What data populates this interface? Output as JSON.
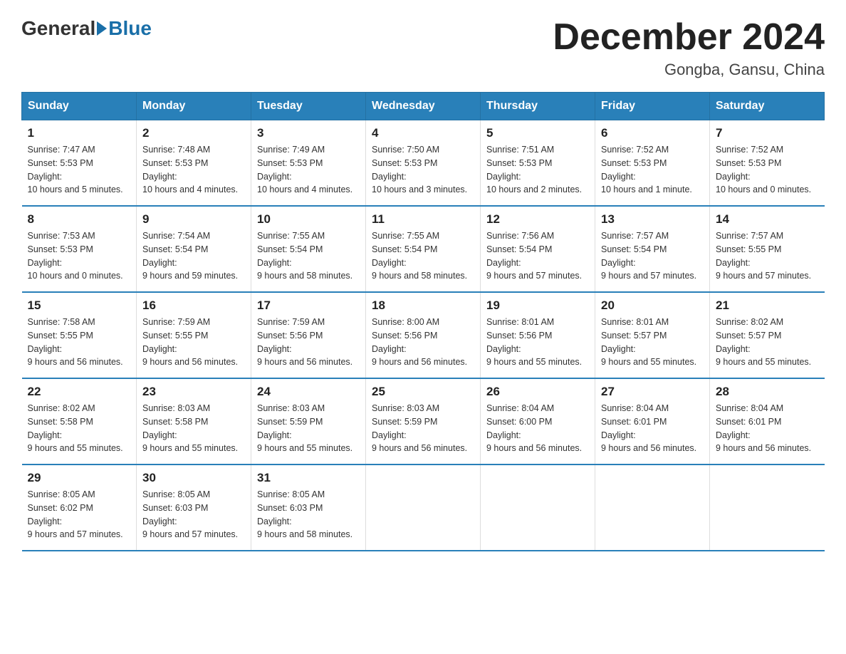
{
  "logo": {
    "general": "General",
    "blue": "Blue"
  },
  "title": "December 2024",
  "subtitle": "Gongba, Gansu, China",
  "days_of_week": [
    "Sunday",
    "Monday",
    "Tuesday",
    "Wednesday",
    "Thursday",
    "Friday",
    "Saturday"
  ],
  "weeks": [
    [
      {
        "day": "1",
        "sunrise": "7:47 AM",
        "sunset": "5:53 PM",
        "daylight": "10 hours and 5 minutes."
      },
      {
        "day": "2",
        "sunrise": "7:48 AM",
        "sunset": "5:53 PM",
        "daylight": "10 hours and 4 minutes."
      },
      {
        "day": "3",
        "sunrise": "7:49 AM",
        "sunset": "5:53 PM",
        "daylight": "10 hours and 4 minutes."
      },
      {
        "day": "4",
        "sunrise": "7:50 AM",
        "sunset": "5:53 PM",
        "daylight": "10 hours and 3 minutes."
      },
      {
        "day": "5",
        "sunrise": "7:51 AM",
        "sunset": "5:53 PM",
        "daylight": "10 hours and 2 minutes."
      },
      {
        "day": "6",
        "sunrise": "7:52 AM",
        "sunset": "5:53 PM",
        "daylight": "10 hours and 1 minute."
      },
      {
        "day": "7",
        "sunrise": "7:52 AM",
        "sunset": "5:53 PM",
        "daylight": "10 hours and 0 minutes."
      }
    ],
    [
      {
        "day": "8",
        "sunrise": "7:53 AM",
        "sunset": "5:53 PM",
        "daylight": "10 hours and 0 minutes."
      },
      {
        "day": "9",
        "sunrise": "7:54 AM",
        "sunset": "5:54 PM",
        "daylight": "9 hours and 59 minutes."
      },
      {
        "day": "10",
        "sunrise": "7:55 AM",
        "sunset": "5:54 PM",
        "daylight": "9 hours and 58 minutes."
      },
      {
        "day": "11",
        "sunrise": "7:55 AM",
        "sunset": "5:54 PM",
        "daylight": "9 hours and 58 minutes."
      },
      {
        "day": "12",
        "sunrise": "7:56 AM",
        "sunset": "5:54 PM",
        "daylight": "9 hours and 57 minutes."
      },
      {
        "day": "13",
        "sunrise": "7:57 AM",
        "sunset": "5:54 PM",
        "daylight": "9 hours and 57 minutes."
      },
      {
        "day": "14",
        "sunrise": "7:57 AM",
        "sunset": "5:55 PM",
        "daylight": "9 hours and 57 minutes."
      }
    ],
    [
      {
        "day": "15",
        "sunrise": "7:58 AM",
        "sunset": "5:55 PM",
        "daylight": "9 hours and 56 minutes."
      },
      {
        "day": "16",
        "sunrise": "7:59 AM",
        "sunset": "5:55 PM",
        "daylight": "9 hours and 56 minutes."
      },
      {
        "day": "17",
        "sunrise": "7:59 AM",
        "sunset": "5:56 PM",
        "daylight": "9 hours and 56 minutes."
      },
      {
        "day": "18",
        "sunrise": "8:00 AM",
        "sunset": "5:56 PM",
        "daylight": "9 hours and 56 minutes."
      },
      {
        "day": "19",
        "sunrise": "8:01 AM",
        "sunset": "5:56 PM",
        "daylight": "9 hours and 55 minutes."
      },
      {
        "day": "20",
        "sunrise": "8:01 AM",
        "sunset": "5:57 PM",
        "daylight": "9 hours and 55 minutes."
      },
      {
        "day": "21",
        "sunrise": "8:02 AM",
        "sunset": "5:57 PM",
        "daylight": "9 hours and 55 minutes."
      }
    ],
    [
      {
        "day": "22",
        "sunrise": "8:02 AM",
        "sunset": "5:58 PM",
        "daylight": "9 hours and 55 minutes."
      },
      {
        "day": "23",
        "sunrise": "8:03 AM",
        "sunset": "5:58 PM",
        "daylight": "9 hours and 55 minutes."
      },
      {
        "day": "24",
        "sunrise": "8:03 AM",
        "sunset": "5:59 PM",
        "daylight": "9 hours and 55 minutes."
      },
      {
        "day": "25",
        "sunrise": "8:03 AM",
        "sunset": "5:59 PM",
        "daylight": "9 hours and 56 minutes."
      },
      {
        "day": "26",
        "sunrise": "8:04 AM",
        "sunset": "6:00 PM",
        "daylight": "9 hours and 56 minutes."
      },
      {
        "day": "27",
        "sunrise": "8:04 AM",
        "sunset": "6:01 PM",
        "daylight": "9 hours and 56 minutes."
      },
      {
        "day": "28",
        "sunrise": "8:04 AM",
        "sunset": "6:01 PM",
        "daylight": "9 hours and 56 minutes."
      }
    ],
    [
      {
        "day": "29",
        "sunrise": "8:05 AM",
        "sunset": "6:02 PM",
        "daylight": "9 hours and 57 minutes."
      },
      {
        "day": "30",
        "sunrise": "8:05 AM",
        "sunset": "6:03 PM",
        "daylight": "9 hours and 57 minutes."
      },
      {
        "day": "31",
        "sunrise": "8:05 AM",
        "sunset": "6:03 PM",
        "daylight": "9 hours and 58 minutes."
      },
      null,
      null,
      null,
      null
    ]
  ],
  "labels": {
    "sunrise": "Sunrise:",
    "sunset": "Sunset:",
    "daylight": "Daylight:"
  }
}
